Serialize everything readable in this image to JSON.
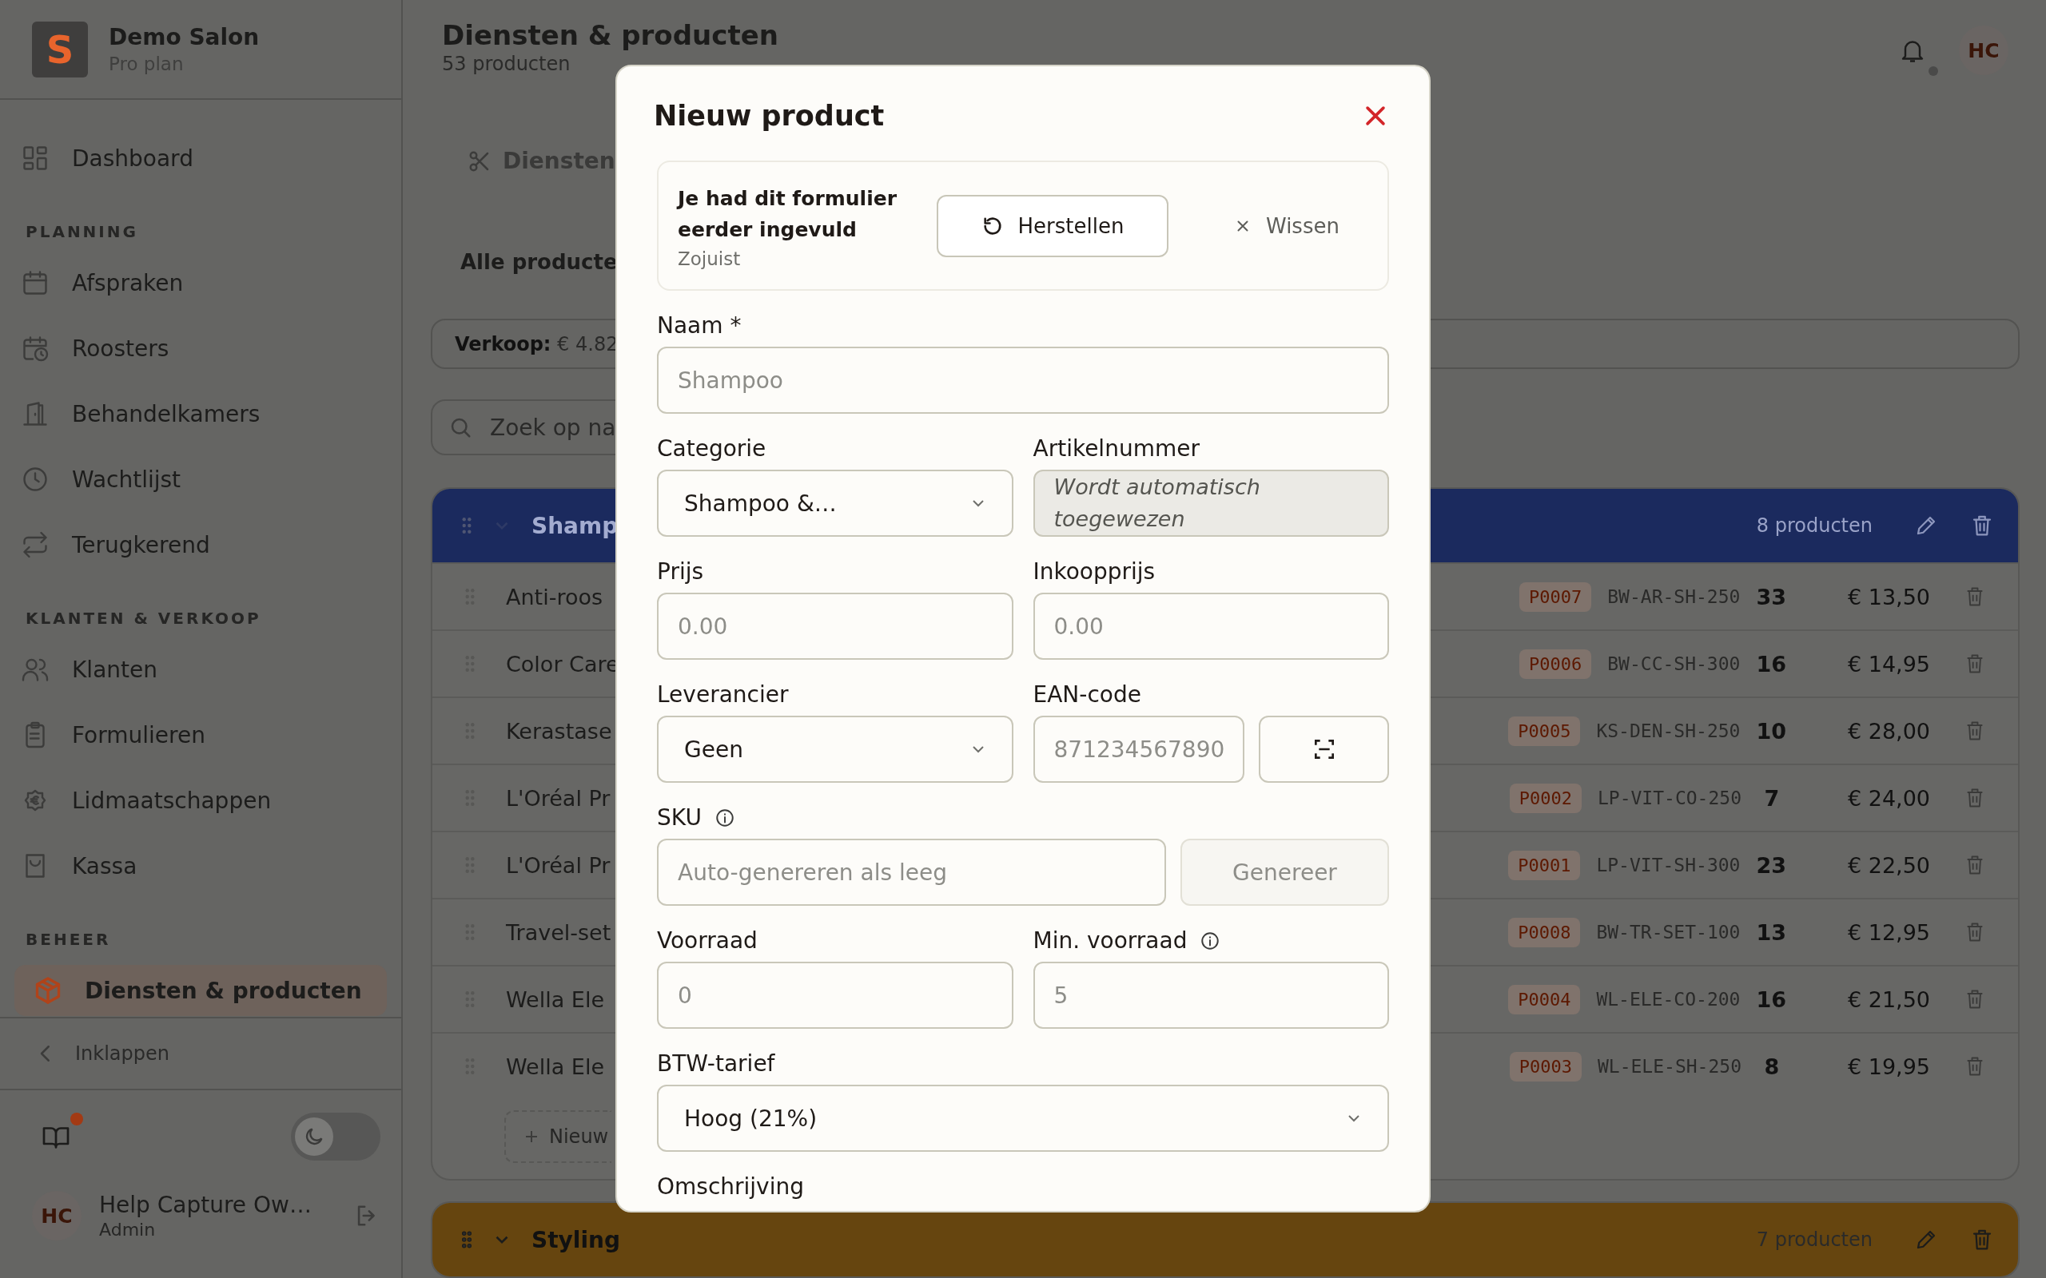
{
  "sidebar": {
    "brand": {
      "logo": "S",
      "name": "Demo Salon",
      "plan": "Pro plan"
    },
    "groups": [
      {
        "items": [
          {
            "label": "Dashboard",
            "selected": false
          }
        ]
      },
      {
        "title": "PLANNING",
        "items": [
          {
            "label": "Afspraken",
            "selected": false
          },
          {
            "label": "Roosters",
            "selected": false
          },
          {
            "label": "Behandelkamers",
            "selected": false
          },
          {
            "label": "Wachtlijst",
            "selected": false
          },
          {
            "label": "Terugkerend",
            "selected": false
          }
        ]
      },
      {
        "title": "KLANTEN & VERKOOP",
        "items": [
          {
            "label": "Klanten",
            "selected": false
          },
          {
            "label": "Formulieren",
            "selected": false
          },
          {
            "label": "Lidmaatschappen",
            "selected": false
          },
          {
            "label": "Kassa",
            "selected": false
          }
        ]
      },
      {
        "title": "BEHEER",
        "items": [
          {
            "label": "Diensten & producten",
            "selected": true
          }
        ]
      }
    ],
    "collapse": "Inklappen",
    "guide_unread": true,
    "dark_mode": {
      "on": false
    },
    "user": {
      "initials": "HC",
      "name": "Help Capture Ow…",
      "role": "Admin"
    }
  },
  "header": {
    "title": "Diensten & producten",
    "subtitle": "53 producten",
    "notifications_unread": true,
    "avatar": "HC"
  },
  "tabs": [
    {
      "label": "Diensten",
      "selected": false
    }
  ],
  "filter_heading": "Alle producte",
  "summary": {
    "label": "Verkoop:",
    "value": "€ 4.82"
  },
  "search": {
    "placeholder": "Zoek op na"
  },
  "categories": [
    {
      "name": "Shamp",
      "color": "#1b2a5e",
      "count": "8 producten",
      "expanded": true,
      "products": [
        {
          "name": "Anti-roos",
          "code": "P0007",
          "sku": "BW-AR-SH-250",
          "stock": "33",
          "price": "€ 13,50"
        },
        {
          "name": "Color Care",
          "code": "P0006",
          "sku": "BW-CC-SH-300",
          "stock": "16",
          "price": "€ 14,95"
        },
        {
          "name": "Kerastase",
          "code": "P0005",
          "sku": "KS-DEN-SH-250",
          "stock": "10",
          "price": "€ 28,00"
        },
        {
          "name": "L'Oréal Pr",
          "code": "P0002",
          "sku": "LP-VIT-CO-250",
          "stock": "7",
          "price": "€ 24,00"
        },
        {
          "name": "L'Oréal Pr",
          "code": "P0001",
          "sku": "LP-VIT-SH-300",
          "stock": "23",
          "price": "€ 22,50"
        },
        {
          "name": "Travel-set",
          "code": "P0008",
          "sku": "BW-TR-SET-100",
          "stock": "13",
          "price": "€ 12,95"
        },
        {
          "name": "Wella Ele",
          "code": "P0004",
          "sku": "WL-ELE-CO-200",
          "stock": "16",
          "price": "€ 21,50"
        },
        {
          "name": "Wella Ele",
          "code": "P0003",
          "sku": "WL-ELE-SH-250",
          "stock": "8",
          "price": "€ 19,95"
        }
      ],
      "add_label": "Nieuw"
    },
    {
      "name": "Styling",
      "color": "#66450f",
      "count": "7 producten",
      "expanded": true
    }
  ],
  "modal": {
    "title": "Nieuw product",
    "draft": {
      "message": "Je had dit formulier eerder ingevuld",
      "time": "Zojuist",
      "restore": "Herstellen",
      "clear": "Wissen"
    },
    "rows": [
      [
        {
          "kind": "input",
          "label": "Naam *",
          "placeholder": "Shampoo"
        }
      ],
      [
        {
          "kind": "select",
          "label": "Categorie",
          "value": "Shampoo &…"
        },
        {
          "kind": "readonly",
          "label": "Artikelnummer",
          "value": "Wordt automatisch toegewezen"
        }
      ],
      [
        {
          "kind": "input",
          "label": "Prijs",
          "placeholder": "0.00"
        },
        {
          "kind": "input",
          "label": "Inkoopprijs",
          "placeholder": "0.00"
        }
      ],
      [
        {
          "kind": "select",
          "label": "Leverancier",
          "value": "Geen"
        },
        {
          "kind": "scan",
          "label": "EAN-code",
          "placeholder": "871234567890"
        }
      ],
      [
        {
          "kind": "generate",
          "label": "SKU",
          "info": true,
          "placeholder": "Auto-genereren als leeg",
          "button": "Genereer",
          "disabled": true
        }
      ],
      [
        {
          "kind": "input",
          "label": "Voorraad",
          "placeholder": "0"
        },
        {
          "kind": "input",
          "label": "Min. voorraad",
          "info": true,
          "placeholder": "5"
        }
      ],
      [
        {
          "kind": "select",
          "label": "BTW-tarief",
          "value": "Hoog (21%)"
        }
      ],
      [
        {
          "kind": "label",
          "label": "Omschrijving"
        }
      ]
    ]
  }
}
